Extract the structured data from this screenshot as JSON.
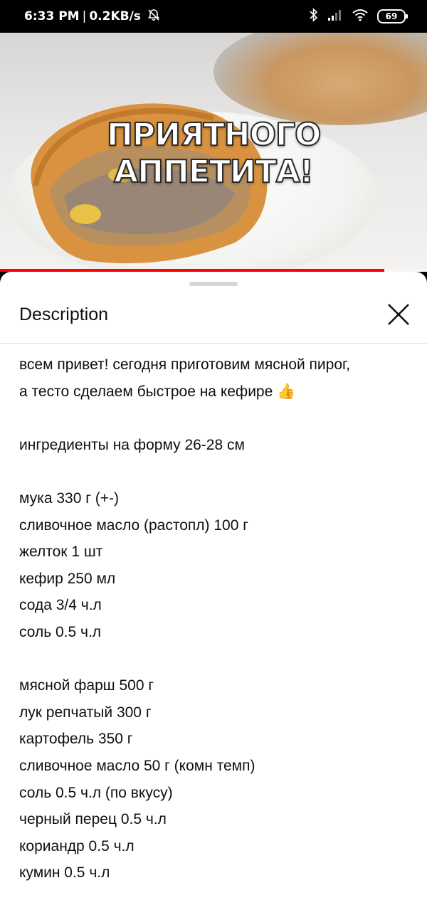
{
  "status_bar": {
    "time": "6:33 PM",
    "separator": "|",
    "speed": "0.2KB/s",
    "battery": "69"
  },
  "video": {
    "overlay_line1": "ПРИЯТНОГО",
    "overlay_line2": "АППЕТИТА!",
    "progress": 0.9
  },
  "description": {
    "title": "Description",
    "lines": [
      "всем привет! сегодня приготовим мясной пирог,",
      "а тесто сделаем быстрое на кефире 👍",
      "",
      "ингредиенты на форму 26-28 см",
      "",
      "мука 330 г (+-)",
      "сливочное масло (растопл) 100 г",
      "желток 1 шт",
      "кефир 250 мл",
      "сода 3/4 ч.л",
      "соль 0.5 ч.л",
      "",
      "мясной фарш 500 г",
      "лук репчатый 300 г",
      "картофель 350 г",
      "сливочное масло 50 г (комн темп)",
      "соль 0.5 ч.л (по вкусу)",
      "черный перец 0.5 ч.л",
      "кориандр 0.5 ч.л",
      "кумин 0.5 ч.л"
    ]
  }
}
